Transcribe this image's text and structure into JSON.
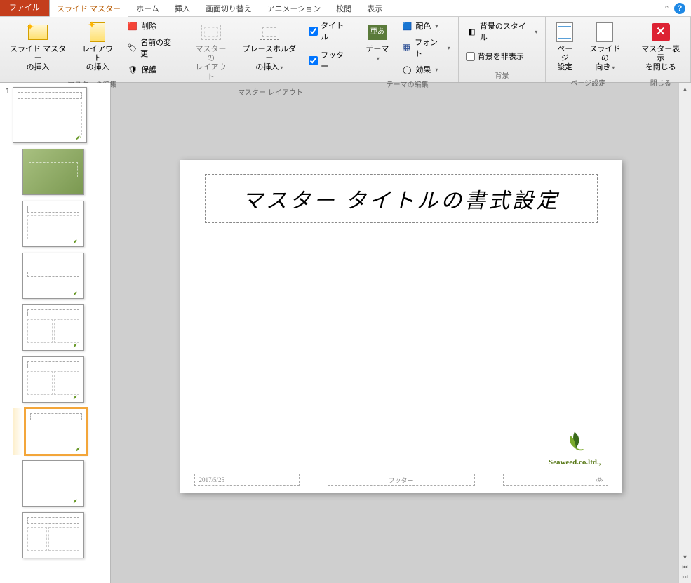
{
  "tabs": {
    "file": "ファイル",
    "slideMaster": "スライド マスター",
    "home": "ホーム",
    "insert": "挿入",
    "transitions": "画面切り替え",
    "animations": "アニメーション",
    "review": "校閲",
    "view": "表示"
  },
  "ribbon": {
    "editMaster": {
      "insertSlideMaster": "スライド マスター\nの挿入",
      "insertLayout": "レイアウト\nの挿入",
      "delete": "削除",
      "rename": "名前の変更",
      "preserve": "保護",
      "groupLabel": "マスターの編集"
    },
    "masterLayout": {
      "masterLayout": "マスターの\nレイアウト",
      "insertPlaceholder": "プレースホルダー\nの挿入",
      "title": "タイトル",
      "footer": "フッター",
      "groupLabel": "マスター レイアウト"
    },
    "editTheme": {
      "themes": "テーマ",
      "colors": "配色",
      "fonts": "フォント",
      "effects": "効果",
      "groupLabel": "テーマの編集"
    },
    "background": {
      "backgroundStyles": "背景のスタイル",
      "hideBackground": "背景を非表示",
      "groupLabel": "背景"
    },
    "pageSetup": {
      "pageSetup": "ページ\n設定",
      "slideOrientation": "スライドの\n向き",
      "groupLabel": "ページ設定"
    },
    "close": {
      "closeMasterView": "マスター表示\nを閉じる",
      "groupLabel": "閉じる"
    }
  },
  "slide": {
    "titlePlaceholder": "マスター タイトルの書式設定",
    "logoText": "Seaweed.co.ltd.,",
    "footerDate": "2017/5/25",
    "footerCenter": "フッター",
    "footerNumber": "‹#›"
  },
  "thumbIndex": "1",
  "icons": {
    "themeGlyph": "亜あ"
  }
}
